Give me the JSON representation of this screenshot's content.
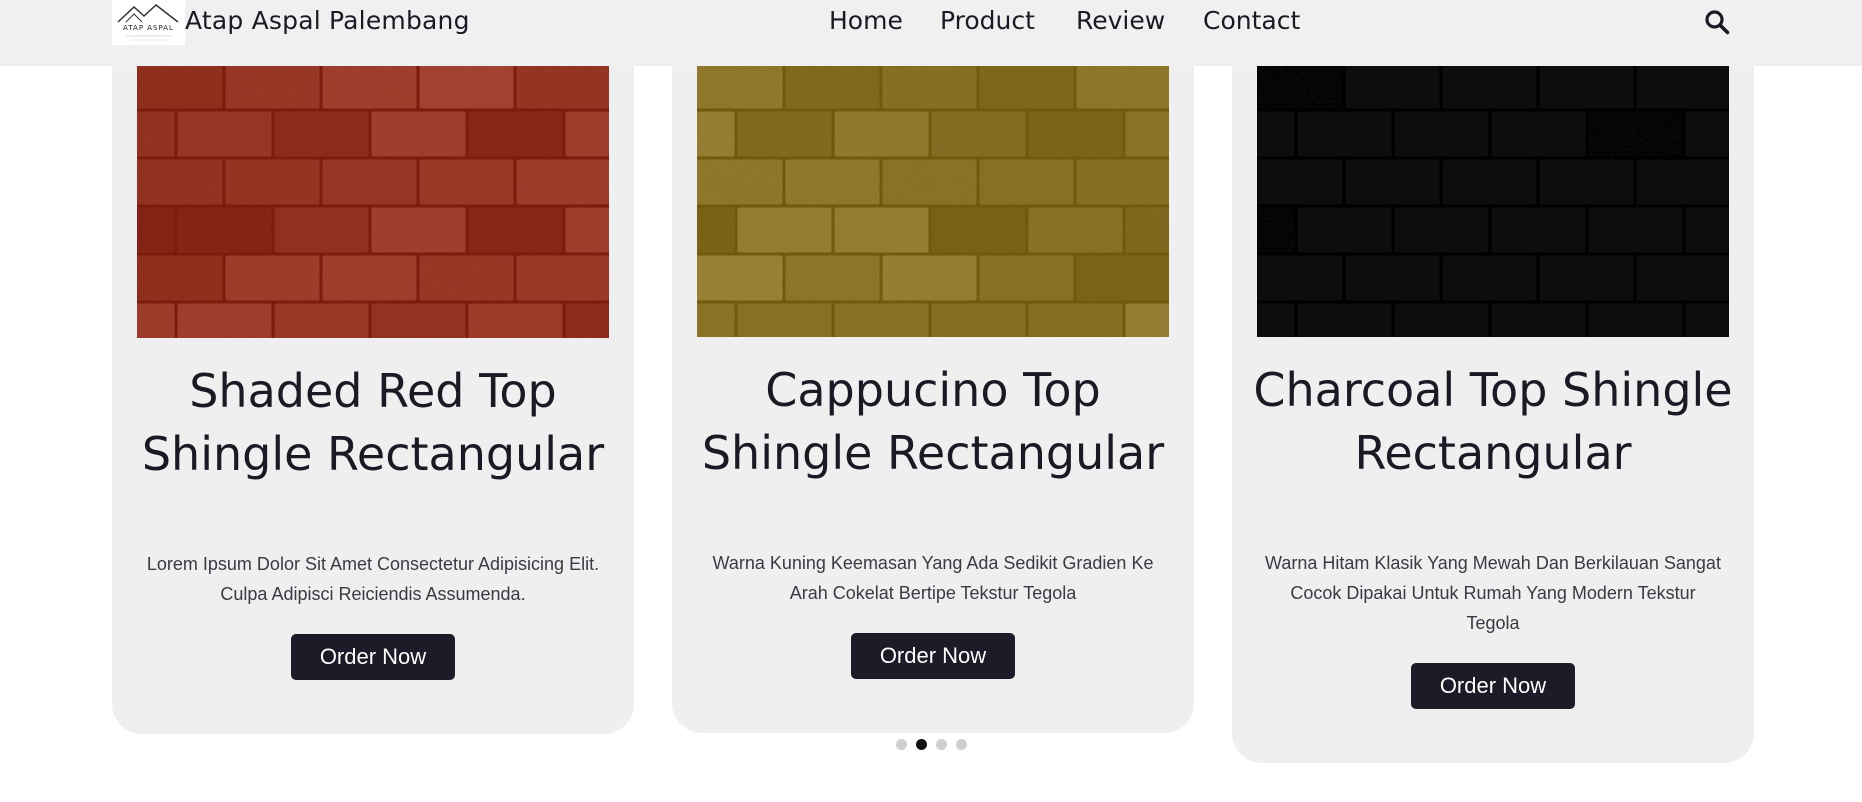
{
  "header": {
    "logo_text": "ATAP ASPAL",
    "brand": "Atap Aspal Palembang",
    "nav": [
      "Home",
      "Product",
      "Review",
      "Contact"
    ],
    "search_icon": "search-icon"
  },
  "products": [
    {
      "title": "Shaded Red Top Shingle Rectangular",
      "description": "Lorem Ipsum Dolor Sit Amet Consectetur Adipisicing Elit. Culpa Adipisci Reiciendis Assumenda.",
      "button": "Order Now",
      "image_color": "#9a3524"
    },
    {
      "title": "Cappucino Top Shingle Rectangular",
      "description": "Warna Kuning Keemasan Yang Ada Sedikit Gradien Ke Arah Cokelat Bertipe Tekstur Tegola",
      "button": "Order Now",
      "image_color": "#8f7628"
    },
    {
      "title": "Charcoal Top Shingle Rectangular",
      "description": "Warna Hitam Klasik Yang Mewah Dan Berkilauan Sangat Cocok Dipakai Untuk Rumah Yang Modern Tekstur Tegola",
      "button": "Order Now",
      "image_color": "#0c0c0c"
    }
  ],
  "carousel": {
    "pages": 4,
    "active_index": 1
  },
  "colors": {
    "header_bg": "#f0f0f0",
    "card_bg": "#efefef",
    "button_bg": "#1c1b27"
  }
}
